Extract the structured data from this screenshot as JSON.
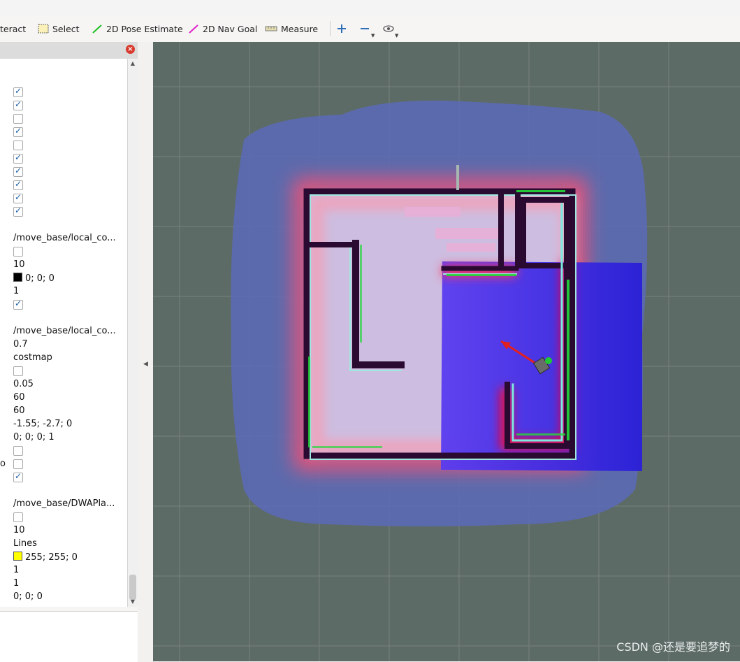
{
  "toolbar": {
    "interact_label": "teract",
    "select_label": "Select",
    "pose_label": "2D Pose Estimate",
    "nav_label": "2D Nav Goal",
    "measure_label": "Measure",
    "icons": [
      "select-icon",
      "pose-estimate-icon",
      "nav-goal-icon",
      "measure-icon",
      "zoom-in-icon",
      "zoom-out-icon",
      "camera-eye-icon"
    ],
    "colors": {
      "pose": "#1fbf1f",
      "nav": "#e020c8"
    }
  },
  "tree": {
    "topic_local_costmap_1": "/move_base/local_co...",
    "queue_size_1": "10",
    "color_1": "0; 0; 0",
    "alpha_1": "1",
    "topic_local_costmap_2": "/move_base/local_co...",
    "alpha_2": "0.7",
    "color_scheme": "costmap",
    "resolution": "0.05",
    "width": "60",
    "height": "60",
    "position": "-1.55; -2.7; 0",
    "orientation": "0; 0; 0; 1",
    "left_cut_char": "o",
    "topic_dwa": "/move_base/DWAPla...",
    "queue_size_2": "10",
    "line_style": "Lines",
    "color_2": "255; 255; 0",
    "line_width": "1",
    "alpha_3": "1",
    "offset": "0; 0; 0",
    "partial_last": "... ",
    "swatch_colors": {
      "black": "#000000",
      "yellow": "#ffff00"
    }
  },
  "viewport": {
    "watermark": "CSDN @还是要追梦的",
    "background": "#5d6b67"
  }
}
